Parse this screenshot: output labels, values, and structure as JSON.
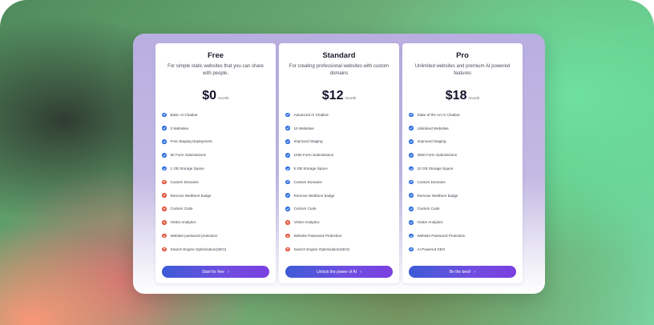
{
  "colors": {
    "check": "#2f6fe0",
    "cross": "#e4553a",
    "button_start": "#3d5bd6",
    "button_end": "#7b3fe0"
  },
  "plans": [
    {
      "name": "Free",
      "description": "For simple static websites that you can share with people.",
      "price": "$0",
      "period": "/month",
      "features": [
        {
          "label": "Basic AI Chatbot",
          "included": true,
          "icon": "check-icon"
        },
        {
          "label": "3 Websites",
          "included": true,
          "icon": "check-icon"
        },
        {
          "label": "Free Staging Deployment",
          "included": true,
          "icon": "check-icon"
        },
        {
          "label": "50 Form Submissions",
          "included": true,
          "icon": "check-icon"
        },
        {
          "label": "1 GB Storage Space",
          "included": true,
          "icon": "check-icon"
        },
        {
          "label": "Custom Domains",
          "included": false,
          "icon": "cross-icon"
        },
        {
          "label": "Remove WebbsAI badge",
          "included": false,
          "icon": "cross-icon"
        },
        {
          "label": "Custom Code",
          "included": false,
          "icon": "cross-icon"
        },
        {
          "label": "Visitor Analytics",
          "included": false,
          "icon": "cross-icon"
        },
        {
          "label": "Website password protection",
          "included": false,
          "icon": "cross-icon"
        },
        {
          "label": "Search Engine Optimization(SEO)",
          "included": false,
          "icon": "cross-icon"
        }
      ],
      "cta": "Start for free",
      "cta_icon": "chevron-right-icon"
    },
    {
      "name": "Standard",
      "description": "For creating professional websites with custom domains",
      "price": "$12",
      "period": "/month",
      "features": [
        {
          "label": "Advanced AI Chatbot",
          "included": true,
          "icon": "check-icon"
        },
        {
          "label": "10 Websites",
          "included": true,
          "icon": "check-icon"
        },
        {
          "label": "Improved Staging",
          "included": true,
          "icon": "check-icon"
        },
        {
          "label": "1000 Form Submissions",
          "included": true,
          "icon": "check-icon"
        },
        {
          "label": "5 GB Storage Space",
          "included": true,
          "icon": "check-icon"
        },
        {
          "label": "Custom Domains",
          "included": true,
          "icon": "check-icon"
        },
        {
          "label": "Remove WebbsAI badge",
          "included": true,
          "icon": "check-icon"
        },
        {
          "label": "Custom Code",
          "included": true,
          "icon": "check-icon"
        },
        {
          "label": "Visitor Analytics",
          "included": false,
          "icon": "cross-icon"
        },
        {
          "label": "Website Password Protection",
          "included": false,
          "icon": "cross-icon"
        },
        {
          "label": "Search Engine Optimization(SEO)",
          "included": false,
          "icon": "cross-icon"
        }
      ],
      "cta": "Unlock the power of AI",
      "cta_icon": "chevron-right-icon"
    },
    {
      "name": "Pro",
      "description": "Unlimited websites and premium AI powered features",
      "price": "$18",
      "period": "/month",
      "features": [
        {
          "label": "State of the Art AI Chatbot",
          "included": true,
          "icon": "check-icon"
        },
        {
          "label": "Unlimited Websites",
          "included": true,
          "icon": "check-icon"
        },
        {
          "label": "Improved Staging",
          "included": true,
          "icon": "check-icon"
        },
        {
          "label": "2500 Form Submissions",
          "included": true,
          "icon": "check-icon"
        },
        {
          "label": "10 GB Storage Space",
          "included": true,
          "icon": "check-icon"
        },
        {
          "label": "Custom Domains",
          "included": true,
          "icon": "check-icon"
        },
        {
          "label": "Remove WebbsAI badge",
          "included": true,
          "icon": "check-icon"
        },
        {
          "label": "Custom Code",
          "included": true,
          "icon": "check-icon"
        },
        {
          "label": "Visitor Analytics",
          "included": true,
          "icon": "check-icon"
        },
        {
          "label": "Website Password Protection",
          "included": true,
          "icon": "check-icon"
        },
        {
          "label": "AI Powered SEO",
          "included": true,
          "icon": "check-icon"
        }
      ],
      "cta": "Be the best!",
      "cta_icon": "chevron-right-icon"
    }
  ]
}
